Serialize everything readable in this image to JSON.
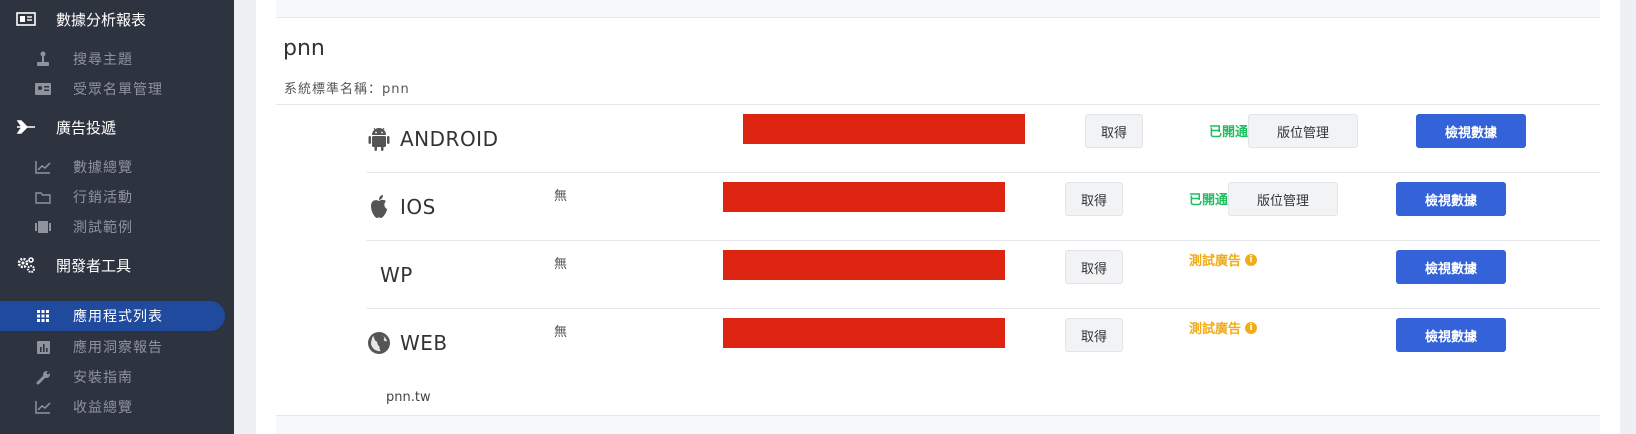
{
  "sidebar": {
    "sections": [
      {
        "label": "數據分析報表",
        "icon": "report-icon"
      },
      {
        "label": "廣告投遞",
        "icon": "plane-icon"
      },
      {
        "label": "開發者工具",
        "icon": "gears-icon"
      }
    ],
    "items": [
      {
        "label": "搜尋主題",
        "icon": "joystick-icon"
      },
      {
        "label": "受眾名單管理",
        "icon": "id-card-icon"
      },
      {
        "label": "數據總覽",
        "icon": "line-chart-icon"
      },
      {
        "label": "行銷活動",
        "icon": "folder-icon"
      },
      {
        "label": "測試範例",
        "icon": "film-icon"
      },
      {
        "label": "應用程式列表",
        "icon": "grid-icon",
        "active": true
      },
      {
        "label": "應用洞察報告",
        "icon": "bar-chart-icon"
      },
      {
        "label": "安裝指南",
        "icon": "wrench-icon"
      },
      {
        "label": "收益總覽",
        "icon": "line-chart-icon"
      }
    ]
  },
  "app": {
    "name": "pnn",
    "standard_name": "系統標準名稱：pnn",
    "domain": "pnn.tw"
  },
  "platforms": [
    {
      "label": "ANDROID",
      "icon": "android-icon",
      "none_text": "",
      "get_label": "取得",
      "status": "已開通",
      "status_type": "enabled",
      "slot_label": "版位管理",
      "view_label": "檢視數據"
    },
    {
      "label": "IOS",
      "icon": "apple-icon",
      "none_text": "無",
      "get_label": "取得",
      "status": "已開通",
      "status_type": "enabled",
      "slot_label": "版位管理",
      "view_label": "檢視數據"
    },
    {
      "label": "WP",
      "icon": "",
      "none_text": "無",
      "get_label": "取得",
      "status": "測試廣告",
      "status_type": "test",
      "slot_label": "",
      "view_label": "檢視數據"
    },
    {
      "label": "WEB",
      "icon": "globe-icon",
      "none_text": "無",
      "get_label": "取得",
      "status": "測試廣告",
      "status_type": "test",
      "slot_label": "",
      "view_label": "檢視數據"
    }
  ],
  "colors": {
    "sidebar_bg": "#2e3340",
    "active_item": "#1f4a9e",
    "enabled_status": "#1fbf60",
    "test_status": "#f0ad1a",
    "view_button": "#3462d8",
    "redacted_bar": "#dc2410"
  }
}
